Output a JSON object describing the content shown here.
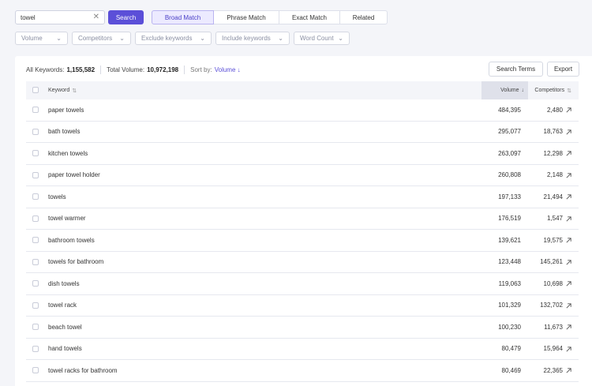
{
  "search": {
    "value": "towel",
    "clear_icon": "close-icon",
    "button_label": "Search"
  },
  "match_tabs": [
    {
      "label": "Broad Match",
      "active": true
    },
    {
      "label": "Phrase Match",
      "active": false
    },
    {
      "label": "Exact Match",
      "active": false
    },
    {
      "label": "Related",
      "active": false
    }
  ],
  "filters": [
    "Volume",
    "Competitors",
    "Exclude keywords",
    "Include keywords",
    "Word Count"
  ],
  "summary": {
    "all_keywords_label": "All Keywords:",
    "all_keywords_value": "1,155,582",
    "total_volume_label": "Total Volume:",
    "total_volume_value": "10,972,198",
    "sort_label": "Sort by:",
    "sort_value": "Volume ↓"
  },
  "actions": {
    "search_terms": "Search Terms",
    "export": "Export"
  },
  "table": {
    "headers": {
      "keyword": "Keyword",
      "volume": "Volume",
      "competitors": "Competitors"
    },
    "rows": [
      {
        "keyword": "paper towels",
        "volume": "484,395",
        "competitors": "2,480"
      },
      {
        "keyword": "bath towels",
        "volume": "295,077",
        "competitors": "18,763"
      },
      {
        "keyword": "kitchen towels",
        "volume": "263,097",
        "competitors": "12,298"
      },
      {
        "keyword": "paper towel holder",
        "volume": "260,808",
        "competitors": "2,148"
      },
      {
        "keyword": "towels",
        "volume": "197,133",
        "competitors": "21,494"
      },
      {
        "keyword": "towel warmer",
        "volume": "176,519",
        "competitors": "1,547"
      },
      {
        "keyword": "bathroom towels",
        "volume": "139,621",
        "competitors": "19,575"
      },
      {
        "keyword": "towels for bathroom",
        "volume": "123,448",
        "competitors": "145,261"
      },
      {
        "keyword": "dish towels",
        "volume": "119,063",
        "competitors": "10,698"
      },
      {
        "keyword": "towel rack",
        "volume": "101,329",
        "competitors": "132,702"
      },
      {
        "keyword": "beach towel",
        "volume": "100,230",
        "competitors": "11,673"
      },
      {
        "keyword": "hand towels",
        "volume": "80,479",
        "competitors": "15,964"
      },
      {
        "keyword": "towel racks for bathroom",
        "volume": "80,469",
        "competitors": "22,365"
      }
    ]
  },
  "colors": {
    "accent": "#5b4fd8",
    "active_tab_bg": "#eceaff",
    "page_bg": "#f4f5f9"
  }
}
